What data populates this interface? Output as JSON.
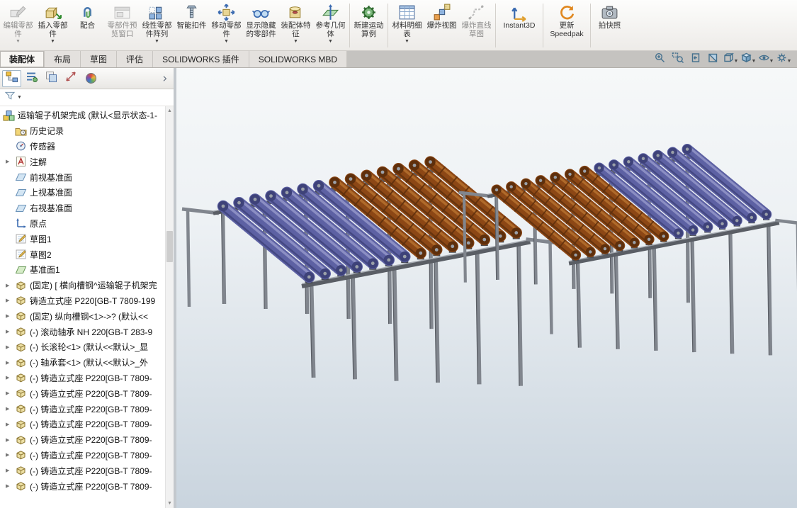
{
  "glyphs": {
    "dropdown_caret": "▼",
    "tree_arrow": "▶",
    "scroll_up": "▲",
    "scroll_down": "▼"
  },
  "colors": {
    "roller_blue": "#5d61a3",
    "roller_blue_dark": "#3e4279",
    "roller_blue_light": "#9093c7",
    "roller_brown": "#8c4715",
    "roller_brown_dark": "#5e2f0c",
    "roller_brown_light": "#b36e2c",
    "frame": "#81868e",
    "frame_dark": "#5a5e65",
    "frame_light": "#a7acb3",
    "bg_top": "#f6f8f9",
    "bg_bottom": "#c9d4de"
  },
  "ribbon": {
    "buttons": [
      {
        "name": "edit-component",
        "label": "编辑零部件",
        "dropdown": true,
        "disabled": true
      },
      {
        "name": "insert-components",
        "label": "插入零部件",
        "dropdown": true
      },
      {
        "name": "mate",
        "label": "配合"
      },
      {
        "name": "component-preview-window",
        "label": "零部件预览窗口",
        "disabled": true
      },
      {
        "name": "linear-component-pattern",
        "label": "线性零部件阵列",
        "dropdown": true
      },
      {
        "name": "smart-fasteners",
        "label": "智能扣件"
      },
      {
        "name": "move-component",
        "label": "移动零部件",
        "dropdown": true
      },
      {
        "name": "show-hidden-components",
        "label": "显示隐藏的零部件"
      },
      {
        "name": "assembly-features",
        "label": "装配体特征",
        "dropdown": true
      },
      {
        "name": "reference-geometry",
        "label": "参考几何体",
        "dropdown": true,
        "sep": true
      },
      {
        "name": "new-motion-study",
        "label": "新建运动算例",
        "sep": true
      },
      {
        "name": "bill-of-materials",
        "label": "材料明细表",
        "dropdown": true
      },
      {
        "name": "exploded-view",
        "label": "爆炸视图"
      },
      {
        "name": "explode-line-sketch",
        "label": "爆炸直线草图",
        "disabled": true,
        "sep": true
      },
      {
        "name": "instant3d",
        "label": "Instant3D",
        "sep": true
      },
      {
        "name": "update-speedpak",
        "label": "更新 Speedpak",
        "sep": true
      },
      {
        "name": "take-snapshot",
        "label": "拍快照"
      }
    ]
  },
  "tabs": {
    "items": [
      {
        "label": "装配体",
        "active": true
      },
      {
        "label": "布局"
      },
      {
        "label": "草图"
      },
      {
        "label": "评估"
      },
      {
        "label": "SOLIDWORKS 插件"
      },
      {
        "label": "SOLIDWORKS MBD"
      }
    ]
  },
  "headsup": {
    "buttons": [
      {
        "name": "zoom-to-fit"
      },
      {
        "name": "zoom-to-area"
      },
      {
        "name": "previous-view"
      },
      {
        "name": "section-view"
      },
      {
        "name": "view-orientation",
        "dropdown": true
      },
      {
        "name": "display-style",
        "dropdown": true
      },
      {
        "name": "hide-show-items",
        "dropdown": true
      },
      {
        "name": "view-settings",
        "dropdown": true
      }
    ]
  },
  "panel": {
    "tabs": [
      {
        "name": "featuremanager",
        "active": true
      },
      {
        "name": "propertymanager"
      },
      {
        "name": "configurationmanager"
      },
      {
        "name": "dimxpertmanager"
      },
      {
        "name": "displaymanager"
      }
    ]
  },
  "tree": {
    "items": [
      {
        "icon": "assembly",
        "label": "运输辊子机架完成 (默认<显示状态-1-",
        "root": true
      },
      {
        "icon": "history",
        "label": "历史记录"
      },
      {
        "icon": "sensors",
        "label": "传感器"
      },
      {
        "icon": "annotations",
        "label": "注解",
        "arrow": true
      },
      {
        "icon": "plane",
        "label": "前视基准面"
      },
      {
        "icon": "plane",
        "label": "上视基准面"
      },
      {
        "icon": "plane",
        "label": "右视基准面"
      },
      {
        "icon": "origin",
        "label": "原点"
      },
      {
        "icon": "sketch",
        "label": "草图1"
      },
      {
        "icon": "sketch",
        "label": "草图2"
      },
      {
        "icon": "plane-feature",
        "label": "基准面1"
      },
      {
        "icon": "part",
        "label": "(固定) [ 横向槽钢^运输辊子机架完",
        "arrow": true
      },
      {
        "icon": "part",
        "label": "铸造立式座 P220[GB-T 7809-199",
        "arrow": true
      },
      {
        "icon": "part",
        "label": "(固定) 纵向槽钢<1>->? (默认<<",
        "arrow": true
      },
      {
        "icon": "part",
        "label": "(-) 滚动轴承 NH 220[GB-T 283-9",
        "arrow": true
      },
      {
        "icon": "part",
        "label": "(-) 长滚轮<1> (默认<<默认>_显",
        "arrow": true
      },
      {
        "icon": "part",
        "label": "(-) 轴承套<1> (默认<<默认>_外",
        "arrow": true
      },
      {
        "icon": "part",
        "label": "(-) 铸造立式座 P220[GB-T 7809-",
        "arrow": true
      },
      {
        "icon": "part",
        "label": "(-) 铸造立式座 P220[GB-T 7809-",
        "arrow": true
      },
      {
        "icon": "part",
        "label": "(-) 铸造立式座 P220[GB-T 7809-",
        "arrow": true
      },
      {
        "icon": "part",
        "label": "(-) 铸造立式座 P220[GB-T 7809-",
        "arrow": true
      },
      {
        "icon": "part",
        "label": "(-) 铸造立式座 P220[GB-T 7809-",
        "arrow": true
      },
      {
        "icon": "part",
        "label": "(-) 铸造立式座 P220[GB-T 7809-",
        "arrow": true
      },
      {
        "icon": "part",
        "label": "(-) 铸造立式座 P220[GB-T 7809-",
        "arrow": true
      },
      {
        "icon": "part",
        "label": "(-) 铸造立式座 P220[GB-T 7809-",
        "arrow": true
      }
    ]
  }
}
